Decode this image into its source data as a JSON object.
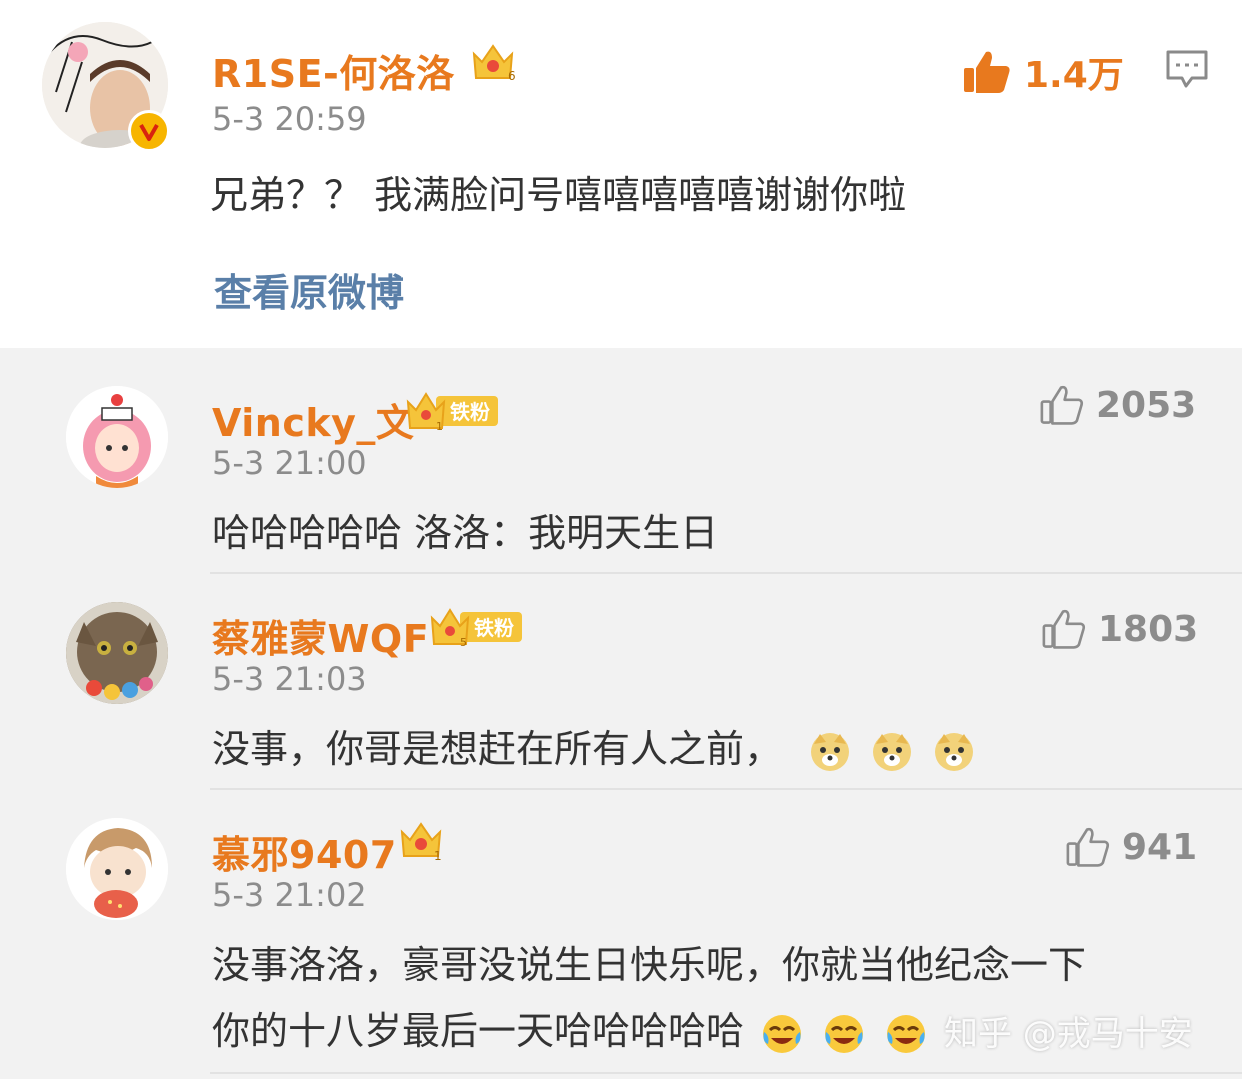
{
  "main": {
    "user": "R1SE-何洛洛",
    "time": "5-3 20:59",
    "text": "兄弟？？ 我满脸问号嘻嘻嘻嘻嘻谢谢你啦",
    "likes": "1.4万",
    "view_original": "查看原微博",
    "crown_level": "6"
  },
  "replies": [
    {
      "user": "Vincky_文",
      "time": "5-3 21:00",
      "text": "哈哈哈哈哈 洛洛：我明天生日",
      "likes": "2053",
      "crown_level": "1",
      "fan_badge": "铁粉"
    },
    {
      "user": "蔡雅蒙WQF",
      "time": "5-3 21:03",
      "text": "没事，你哥是想赶在所有人之前，",
      "likes": "1803",
      "crown_level": "5",
      "fan_badge": "铁粉"
    },
    {
      "user": "慕邪9407",
      "time": "5-3 21:02",
      "text_line1": "没事洛洛，豪哥没说生日快乐呢，你就当他纪念一下",
      "text_line2": "你的十八岁最后一天哈哈哈哈哈",
      "likes": "941",
      "crown_level": "1"
    }
  ],
  "watermark": "知乎 @戎马十安",
  "colors": {
    "name": "#e8791e",
    "like_active": "#e8791e",
    "link": "#5a7fa8",
    "muted": "#8c8c8c",
    "gold": "#f5c43a"
  }
}
